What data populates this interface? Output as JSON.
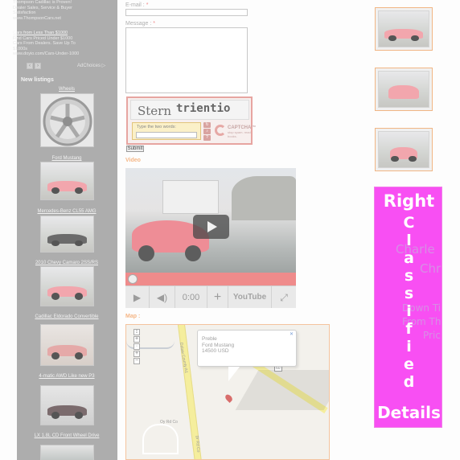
{
  "sidebar": {
    "ad_top_lines": [
      "Thompson Cadillac is Proven!",
      "Dealer Sales, Service & Buyer",
      "Satisfaction",
      "www.ThompsonCars.net"
    ],
    "ad2_title_lines": [
      "Cars from Less Than $1000",
      "Find Cars Priced Under $1000",
      "Cars From Dealers. Save Up To",
      "$1000s"
    ],
    "ad2_url": "www.doyio.com/Cars-Under-1000",
    "adchoices_label": "AdChoices ▷",
    "new_listings_title": "New listings",
    "listings": [
      {
        "title": "Wheels"
      },
      {
        "title": "Ford Mustang"
      },
      {
        "title": "Mercedes-Benz CL55 AMG"
      },
      {
        "title": "2010 Chevy Camaro 2SS/RS"
      },
      {
        "title": "Cadillac Eldorado Convertible"
      },
      {
        "title": "4-matic AWD Like new P3"
      },
      {
        "title": "LX 1.8L CD Front Wheel Drive"
      }
    ]
  },
  "form": {
    "email_label": "E-mail :",
    "message_label": "Message :",
    "required_mark": "*",
    "captcha_word1": "Stern",
    "captcha_word2": "trientio",
    "captcha_hint": "Type the two words:",
    "captcha_brand": "CAPTCHA™",
    "captcha_tagline": "stop spam. read books.",
    "submit_label": "Submit"
  },
  "video": {
    "heading": "Video",
    "time": "0:00",
    "youtube_label": "YouTube"
  },
  "map": {
    "heading": "Map :",
    "info_lines": [
      "Preble",
      "Ford Mustang",
      "14500 USD"
    ],
    "road_labels": [
      "Dalaw County A1",
      "Oy Rd Co",
      "Dr Rd Co",
      "60"
    ]
  },
  "right_banner": {
    "word_top": "Right",
    "vertical_letters": [
      "C",
      "l",
      "a",
      "s",
      "s",
      "i",
      "f",
      "i",
      "e",
      "d"
    ],
    "word_bottom": "Details",
    "bg_fragments": [
      "Charle",
      "Chr",
      "Down Ti",
      "From Th",
      "Pric"
    ],
    "bg_color": "#f84ff3"
  },
  "colors": {
    "sidebar": "#adadad",
    "accent_orange": "#f5b686",
    "video_progress": "#ef8b8b"
  }
}
